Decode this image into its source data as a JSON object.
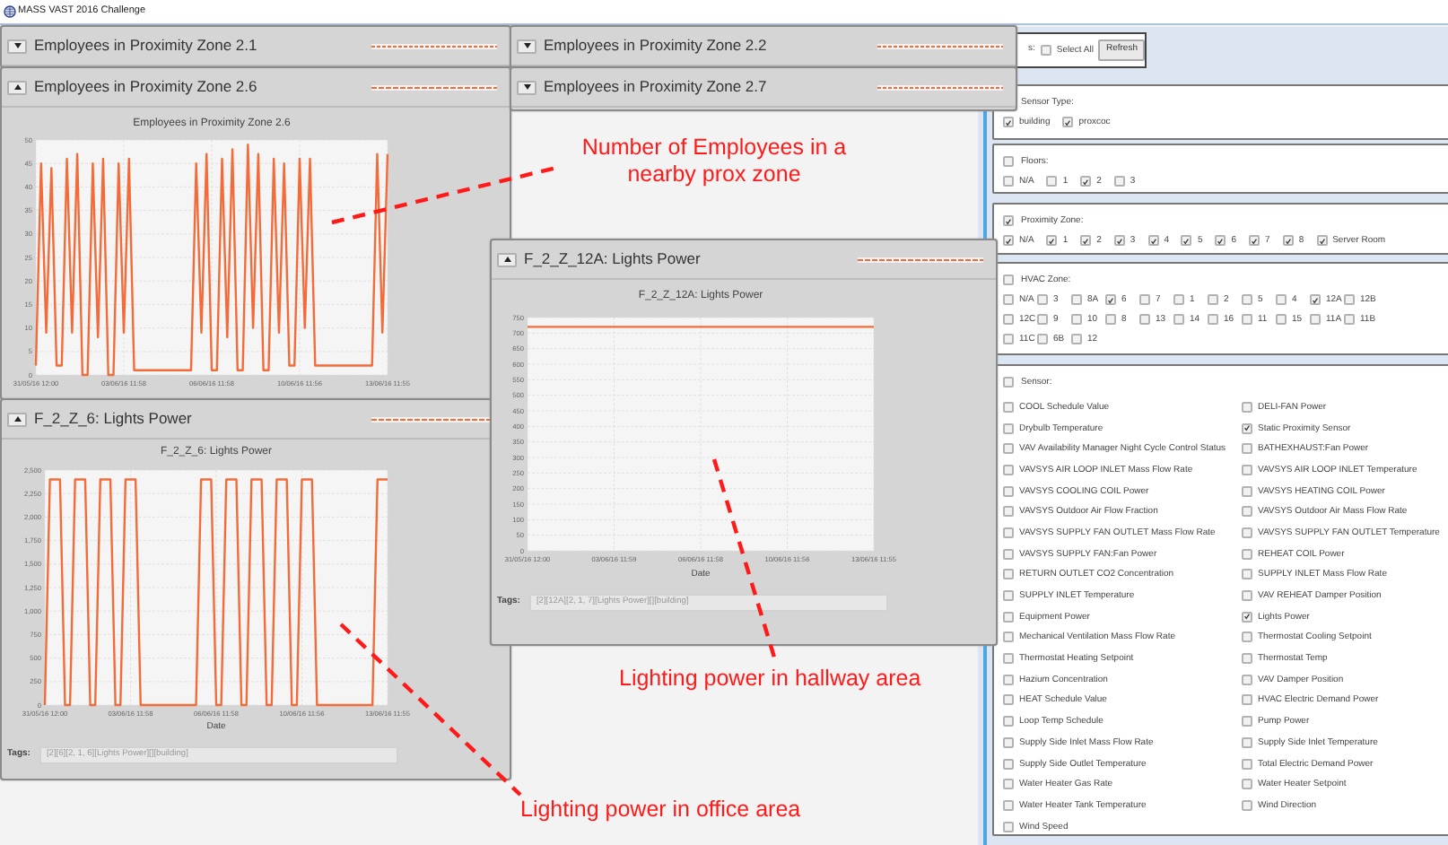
{
  "window": {
    "title": "MASS VAST 2016 Challenge"
  },
  "panels": [
    {
      "title": "Employees in Proximity Zone 2.1",
      "expanded": false
    },
    {
      "title": "Employees in Proximity Zone 2.6",
      "expanded": true,
      "chart_data": {
        "type": "line",
        "title": "Employees in Proximity Zone 2.6",
        "grid": true,
        "ylim": [
          0,
          50
        ],
        "yticks": [
          0,
          5,
          10,
          15,
          20,
          25,
          30,
          35,
          40,
          45,
          50
        ],
        "categories": [
          "31/05/16 12:00",
          null,
          null,
          null,
          null,
          null,
          null,
          null,
          null,
          null,
          null,
          null,
          null,
          null,
          null,
          null,
          null,
          "03/06/16 11:58",
          null,
          null,
          null,
          null,
          null,
          null,
          null,
          null,
          null,
          null,
          null,
          null,
          null,
          null,
          null,
          null,
          "06/06/16 11:58",
          null,
          null,
          null,
          null,
          null,
          null,
          null,
          null,
          null,
          null,
          null,
          null,
          null,
          null,
          null,
          null,
          "10/06/16 11:56",
          null,
          null,
          null,
          null,
          null,
          null,
          null,
          null,
          null,
          null,
          null,
          null,
          null,
          null,
          null,
          null,
          "13/06/16 11:55"
        ],
        "series": [
          {
            "color": "#f26b38",
            "values": [
              2,
              45,
              9,
              44,
              2,
              2,
              46,
              9,
              47,
              0,
              0,
              45,
              8,
              46,
              0,
              0,
              45,
              9,
              46,
              1,
              1,
              1,
              1,
              1,
              1,
              1,
              1,
              1,
              1,
              1,
              1,
              45,
              9,
              47,
              1,
              1,
              46,
              8,
              48,
              1,
              1,
              49,
              10,
              47,
              1,
              1,
              46,
              9,
              45,
              2,
              2,
              46,
              10,
              46,
              2,
              2,
              2,
              2,
              2,
              2,
              2,
              2,
              2,
              2,
              2,
              2,
              47,
              9,
              47
            ]
          }
        ]
      }
    },
    {
      "title": "F_2_Z_6: Lights Power",
      "expanded": true,
      "chart_data": {
        "type": "line",
        "title": "F_2_Z_6: Lights Power",
        "grid": true,
        "xlabel": "Date",
        "ylim": [
          0,
          2500
        ],
        "yticks": [
          {
            "value": 0,
            "label": "0"
          },
          {
            "value": 250,
            "label": "250"
          },
          {
            "value": 500,
            "label": "500"
          },
          {
            "value": 750,
            "label": "750"
          },
          {
            "value": 1000,
            "label": "1,000"
          },
          {
            "value": 1250,
            "label": "1,250"
          },
          {
            "value": 1500,
            "label": "1,500"
          },
          {
            "value": 1750,
            "label": "1,750"
          },
          {
            "value": 2000,
            "label": "2,000"
          },
          {
            "value": 2250,
            "label": "2,250"
          },
          {
            "value": 2500,
            "label": "2,500"
          }
        ],
        "categories": [
          "31/05/16 12:00",
          null,
          null,
          null,
          null,
          null,
          null,
          null,
          null,
          null,
          null,
          null,
          null,
          null,
          null,
          null,
          null,
          "03/06/16 11:58",
          null,
          null,
          null,
          null,
          null,
          null,
          null,
          null,
          null,
          null,
          null,
          null,
          null,
          null,
          null,
          null,
          "06/06/16 11:58",
          null,
          null,
          null,
          null,
          null,
          null,
          null,
          null,
          null,
          null,
          null,
          null,
          null,
          null,
          null,
          null,
          "10/06/16 11:56",
          null,
          null,
          null,
          null,
          null,
          null,
          null,
          null,
          null,
          null,
          null,
          null,
          null,
          null,
          null,
          null,
          "13/06/16 11:55"
        ],
        "series": [
          {
            "color": "#f26b38",
            "values": [
              0,
              2400,
              2400,
              2400,
              0,
              0,
              2400,
              2400,
              2400,
              0,
              0,
              2400,
              2400,
              2400,
              0,
              0,
              2400,
              2400,
              2400,
              0,
              0,
              0,
              0,
              0,
              0,
              0,
              0,
              0,
              0,
              0,
              0,
              2400,
              2400,
              2400,
              0,
              0,
              2400,
              2400,
              2400,
              0,
              0,
              2400,
              2400,
              2400,
              0,
              0,
              2400,
              2400,
              2400,
              0,
              0,
              2400,
              2400,
              2400,
              0,
              0,
              0,
              0,
              0,
              0,
              0,
              0,
              0,
              0,
              0,
              0,
              2400,
              2400,
              2400
            ]
          }
        ]
      },
      "tags": {
        "label": "Tags:",
        "value": "[2][6][2, 1, 6][Lights Power][][building]"
      }
    },
    {
      "title": "Employees in Proximity Zone 2.2",
      "expanded": false
    },
    {
      "title": "Employees in Proximity Zone 2.7",
      "expanded": false
    },
    {
      "title": "F_2_Z_12A: Lights Power",
      "expanded": true,
      "chart_data": {
        "type": "line",
        "title": "F_2_Z_12A: Lights Power",
        "grid": true,
        "xlabel": "Date",
        "ylim": [
          0,
          750
        ],
        "yticks": [
          0,
          50,
          100,
          150,
          200,
          250,
          300,
          350,
          400,
          450,
          500,
          550,
          600,
          650,
          700,
          750
        ],
        "categories": [
          "31/05/16 12:00",
          "03/06/16 11:59",
          "06/06/16 11:58",
          "10/06/16 11:56",
          "13/06/16 11:55"
        ],
        "series": [
          {
            "color": "#f26b38",
            "values": [
              720,
              720,
              720,
              720,
              720
            ]
          }
        ]
      },
      "tags": {
        "label": "Tags:",
        "value": "[2][12A][2, 1, 7][Lights Power][][building]"
      }
    }
  ],
  "annotations": [
    {
      "text": "Number of Employees in a nearby prox zone"
    },
    {
      "text": "Lighting power in hallway area"
    },
    {
      "text": "Lighting power in office area"
    }
  ],
  "filters": {
    "prefix": "s:",
    "select_all": {
      "label": "Select All",
      "checked": false
    },
    "refresh_button": "Refresh",
    "groups": [
      {
        "kind": "row",
        "label": "Sensor Type:",
        "items": [
          {
            "label": "building",
            "checked": true
          },
          {
            "label": "proxcoc",
            "checked": true
          }
        ]
      },
      {
        "kind": "row",
        "label": "Floors:",
        "checked": false,
        "items": [
          {
            "label": "N/A",
            "checked": false
          },
          {
            "label": "1",
            "checked": false
          },
          {
            "label": "2",
            "checked": true
          },
          {
            "label": "3",
            "checked": false
          }
        ]
      },
      {
        "kind": "row",
        "label": "Proximity Zone:",
        "checked": true,
        "items": [
          {
            "label": "N/A",
            "checked": true
          },
          {
            "label": "1",
            "checked": true
          },
          {
            "label": "2",
            "checked": true
          },
          {
            "label": "3",
            "checked": true
          },
          {
            "label": "4",
            "checked": true
          },
          {
            "label": "5",
            "checked": true
          },
          {
            "label": "6",
            "checked": true
          },
          {
            "label": "7",
            "checked": true
          },
          {
            "label": "8",
            "checked": true
          },
          {
            "label": "Server Room",
            "checked": true
          }
        ]
      },
      {
        "kind": "wrap",
        "label": "HVAC Zone:",
        "checked": false,
        "items": [
          {
            "label": "N/A",
            "checked": false
          },
          {
            "label": "3",
            "checked": false
          },
          {
            "label": "8A",
            "checked": false
          },
          {
            "label": "6",
            "checked": true
          },
          {
            "label": "7",
            "checked": false
          },
          {
            "label": "1",
            "checked": false
          },
          {
            "label": "2",
            "checked": false
          },
          {
            "label": "5",
            "checked": false
          },
          {
            "label": "4",
            "checked": false
          },
          {
            "label": "12A",
            "checked": true
          },
          {
            "label": "12B",
            "checked": false
          },
          {
            "label": "12C",
            "checked": false
          },
          {
            "label": "9",
            "checked": false
          },
          {
            "label": "10",
            "checked": false
          },
          {
            "label": "8",
            "checked": false
          },
          {
            "label": "13",
            "checked": false
          },
          {
            "label": "14",
            "checked": false
          },
          {
            "label": "16",
            "checked": false
          },
          {
            "label": "11",
            "checked": false
          },
          {
            "label": "15",
            "checked": false
          },
          {
            "label": "11A",
            "checked": false
          },
          {
            "label": "11B",
            "checked": false
          },
          {
            "label": "11C",
            "checked": false
          },
          {
            "label": "6B",
            "checked": false
          },
          {
            "label": "12",
            "checked": false
          }
        ]
      },
      {
        "kind": "columns",
        "label": "Sensor:",
        "checked": false,
        "items": [
          {
            "label": "COOL Schedule Value",
            "checked": false
          },
          {
            "label": "DELI-FAN Power",
            "checked": false
          },
          {
            "label": "Drybulb Temperature",
            "checked": false
          },
          {
            "label": "Static Proximity Sensor",
            "checked": true
          },
          {
            "label": "VAV Availability Manager Night Cycle Control Status",
            "checked": false
          },
          {
            "label": "BATHEXHAUST:Fan Power",
            "checked": false
          },
          {
            "label": "VAVSYS AIR LOOP INLET Mass Flow Rate",
            "checked": false
          },
          {
            "label": "VAVSYS AIR LOOP INLET Temperature",
            "checked": false
          },
          {
            "label": "VAVSYS COOLING COIL Power",
            "checked": false
          },
          {
            "label": "VAVSYS HEATING COIL Power",
            "checked": false
          },
          {
            "label": "VAVSYS Outdoor Air Flow Fraction",
            "checked": false
          },
          {
            "label": "VAVSYS Outdoor Air Mass Flow Rate",
            "checked": false
          },
          {
            "label": "VAVSYS SUPPLY FAN OUTLET Mass Flow Rate",
            "checked": false
          },
          {
            "label": "VAVSYS SUPPLY FAN OUTLET Temperature",
            "checked": false
          },
          {
            "label": "VAVSYS SUPPLY FAN:Fan Power",
            "checked": false
          },
          {
            "label": "REHEAT COIL Power",
            "checked": false
          },
          {
            "label": "RETURN OUTLET CO2 Concentration",
            "checked": false
          },
          {
            "label": "SUPPLY INLET Mass Flow Rate",
            "checked": false
          },
          {
            "label": "SUPPLY INLET Temperature",
            "checked": false
          },
          {
            "label": "VAV REHEAT Damper Position",
            "checked": false
          },
          {
            "label": "Equipment Power",
            "checked": false
          },
          {
            "label": "Lights Power",
            "checked": true
          },
          {
            "label": "Mechanical Ventilation Mass Flow Rate",
            "checked": false
          },
          {
            "label": "Thermostat Cooling Setpoint",
            "checked": false
          },
          {
            "label": "Thermostat Heating Setpoint",
            "checked": false
          },
          {
            "label": "Thermostat Temp",
            "checked": false
          },
          {
            "label": "Hazium Concentration",
            "checked": false
          },
          {
            "label": "VAV Damper Position",
            "checked": false
          },
          {
            "label": "HEAT Schedule Value",
            "checked": false
          },
          {
            "label": "HVAC Electric Demand Power",
            "checked": false
          },
          {
            "label": "Loop Temp Schedule",
            "checked": false
          },
          {
            "label": "Pump Power",
            "checked": false
          },
          {
            "label": "Supply Side Inlet Mass Flow Rate",
            "checked": false
          },
          {
            "label": "Supply Side Inlet Temperature",
            "checked": false
          },
          {
            "label": "Supply Side Outlet Temperature",
            "checked": false
          },
          {
            "label": "Total Electric Demand Power",
            "checked": false
          },
          {
            "label": "Water Heater Gas Rate",
            "checked": false
          },
          {
            "label": "Water Heater Setpoint",
            "checked": false
          },
          {
            "label": "Water Heater Tank Temperature",
            "checked": false
          },
          {
            "label": "Wind Direction",
            "checked": false
          },
          {
            "label": "Wind Speed",
            "checked": false
          }
        ]
      }
    ]
  }
}
